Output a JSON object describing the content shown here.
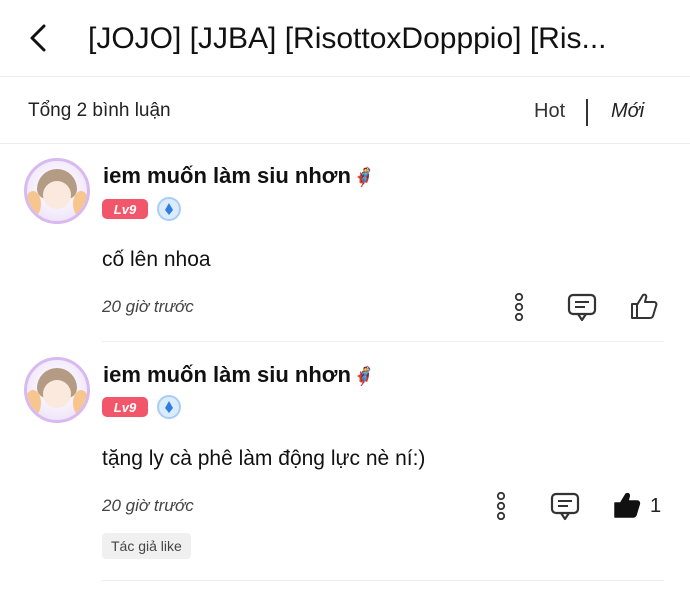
{
  "header": {
    "title": "[JOJO] [JJBA] [RisottoxDopppio] [Ris..."
  },
  "sortbar": {
    "total": "Tổng 2 bình luận",
    "hot_label": "Hot",
    "new_label": "Mới"
  },
  "comments": [
    {
      "username": "iem muốn làm siu nhơn",
      "level": "Lv9",
      "text": "cố lên nhoa",
      "time": "20 giờ trước",
      "likes": ""
    },
    {
      "username": "iem muốn làm siu nhơn",
      "level": "Lv9",
      "text": "tặng ly cà phê làm động lực nè ní:)",
      "time": "20 giờ trước",
      "likes": "1",
      "tag": "Tác giả like"
    }
  ],
  "colors": {
    "level_badge": "#f2566b",
    "accent": "#111111"
  },
  "icons": [
    "back-chevron-icon",
    "more-vertical-icon",
    "reply-comment-icon",
    "thumbs-up-icon",
    "verified-badge-icon",
    "superhero-emoji-icon"
  ]
}
